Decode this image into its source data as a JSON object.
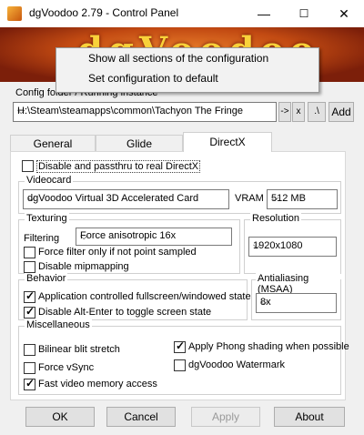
{
  "window": {
    "title": "dgVoodoo 2.79 - Control Panel",
    "minimize": "—",
    "maximize": "☐",
    "close": "✕"
  },
  "banner": {
    "logo_text": "dgVoodoo"
  },
  "context_menu": {
    "items": [
      "Show all sections of the configuration",
      "Set configuration to default"
    ]
  },
  "config": {
    "label": "Config folder / Running instance",
    "path": "H:\\Steam\\steamapps\\common\\Tachyon The Fringe",
    "btn_arrow": "->",
    "btn_x": "x",
    "btn_dot": ".\\",
    "btn_add": "Add"
  },
  "tabs": [
    "General",
    "Glide",
    "DirectX"
  ],
  "directx": {
    "disable_passthru": {
      "label": "Disable and passthru to real DirectX",
      "checked": false
    },
    "videocard": {
      "title": "Videocard",
      "value": "dgVoodoo Virtual 3D Accelerated Card",
      "vram_label": "VRAM",
      "vram_value": "512 MB"
    },
    "texturing": {
      "title": "Texturing",
      "filtering_label": "Filtering",
      "filtering_value": "Force anisotropic 16x",
      "force_filter": {
        "label": "Force filter only if not point sampled",
        "checked": false
      },
      "disable_mip": {
        "label": "Disable mipmapping",
        "checked": false
      }
    },
    "resolution": {
      "title": "Resolution",
      "value": "1920x1080"
    },
    "behavior": {
      "title": "Behavior",
      "app_fullscreen": {
        "label": "Application controlled fullscreen/windowed state",
        "checked": true
      },
      "alt_enter": {
        "label": "Disable Alt-Enter to toggle screen state",
        "checked": true
      }
    },
    "antialiasing": {
      "title": "Antialiasing (MSAA)",
      "value": "8x"
    },
    "misc": {
      "title": "Miscellaneous",
      "bilinear": {
        "label": "Bilinear blit stretch",
        "checked": false
      },
      "force_vsync": {
        "label": "Force vSync",
        "checked": false
      },
      "fast_memory": {
        "label": "Fast video memory access",
        "checked": true
      },
      "phong": {
        "label": "Apply Phong shading when possible",
        "checked": true
      },
      "watermark": {
        "label": "dgVoodoo Watermark",
        "checked": false
      }
    }
  },
  "buttons": {
    "ok": "OK",
    "cancel": "Cancel",
    "apply": "Apply",
    "about": "About"
  },
  "icons": {
    "dropdown": "chevron-down-icon",
    "check": "check-icon"
  }
}
